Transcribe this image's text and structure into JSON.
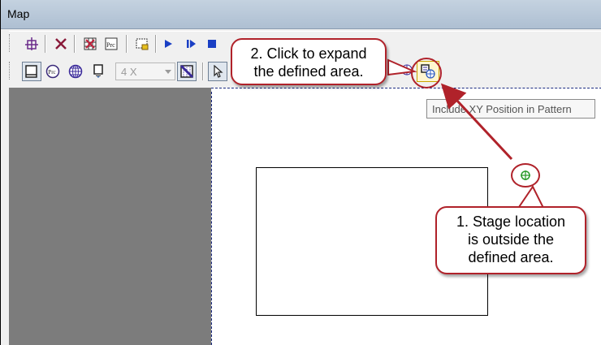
{
  "window": {
    "title": "Map"
  },
  "toolbar2": {
    "objective_value": "4 X"
  },
  "tooltip": {
    "text": "Include XY Position in Pattern"
  },
  "callouts": {
    "expand": {
      "line1": "2. Click to expand",
      "line2": "the defined area."
    },
    "stage": {
      "line1": "1. Stage location",
      "line2": "is outside the",
      "line3": "defined area."
    }
  },
  "icons": {
    "toolbar1": [
      "add-point-icon",
      "delete-icon",
      "grid-icon",
      "pattern-icon",
      "region-icon",
      "play-icon",
      "step-icon",
      "stop-icon"
    ],
    "toolbar2": [
      "sample-view-icon",
      "pattern-file-icon",
      "globe-icon",
      "objective-icon",
      "grid-overlay-icon",
      "pointer-icon",
      "include-xy-position-icon"
    ]
  },
  "colors": {
    "accent": "#b0222a",
    "canvas_border": "#1a2a80",
    "play": "#1a3fc4"
  }
}
